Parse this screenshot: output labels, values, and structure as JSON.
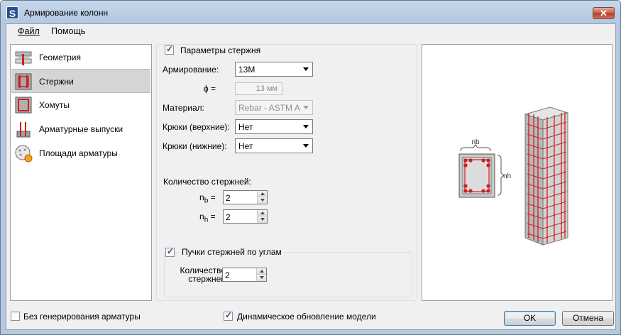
{
  "window": {
    "title": "Армирование колонн",
    "app_icon_letter": "S",
    "close_glyph": "✕"
  },
  "menu": [
    {
      "label": "Файл",
      "underline_index": 0
    },
    {
      "label": "Помощь"
    }
  ],
  "sidebar": {
    "items": [
      {
        "label": "Геометрия",
        "icon": "geometry-icon",
        "active": false
      },
      {
        "label": "Стержни",
        "icon": "rebar-bars-icon",
        "active": true
      },
      {
        "label": "Хомуты",
        "icon": "stirrups-icon",
        "active": false
      },
      {
        "label": "Арматурные выпуски",
        "icon": "rebar-dowels-icon",
        "active": false
      },
      {
        "label": "Площади арматуры",
        "icon": "rebar-area-icon",
        "active": false
      }
    ]
  },
  "params": {
    "section_checkbox": {
      "label": "Параметры стержня",
      "checked": true
    },
    "reinforcement": {
      "label": "Армирование:",
      "value": "13M"
    },
    "phi": {
      "label": "ϕ =",
      "value": "13 мм"
    },
    "material": {
      "label": "Материал:",
      "value": "Rebar - ASTM A"
    },
    "hooks_top": {
      "label": "Крюки (верхние):",
      "value": "Нет"
    },
    "hooks_bottom": {
      "label": "Крюки (нижние):",
      "value": "Нет"
    },
    "bar_count_label": "Количество стержней:",
    "nb": {
      "label_main": "n",
      "label_sub": "b",
      "eq": "=",
      "value": "2"
    },
    "nh": {
      "label_main": "n",
      "label_sub": "h",
      "eq": "=",
      "value": "2"
    },
    "corner_bundles": {
      "label": "Пучки стержней по углам",
      "checked": true
    },
    "bundle_count": {
      "label_line1": "Количество",
      "label_line2": "стержней",
      "value": "2"
    }
  },
  "preview": {
    "label_nb": "nb",
    "label_nh": "nh"
  },
  "footer": {
    "no_generation": {
      "label": "Без генерирования арматуры",
      "checked": false
    },
    "dynamic_update": {
      "label": "Динамическое обновление модели",
      "checked": true
    },
    "ok_label": "OK",
    "cancel_label": "Отмена"
  },
  "colors": {
    "rebar": "#cc1f1f",
    "concrete": "#cfcfcf",
    "accent": "#3c7fb1"
  }
}
